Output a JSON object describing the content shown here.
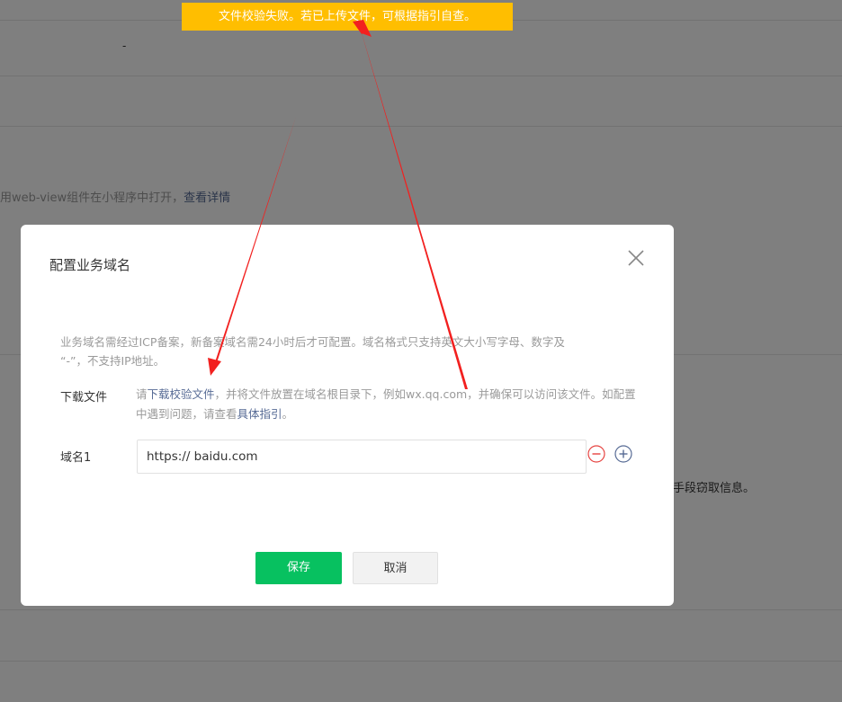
{
  "toast": {
    "message": "文件校验失败。若已上传文件，可根据指引自查。"
  },
  "background": {
    "dash": "-",
    "description_prefix": "用web-view组件在小程序中打开，",
    "description_link": "查看详情",
    "right_text": "手段窃取信息。"
  },
  "dialog": {
    "title": "配置业务域名",
    "tip_line1": "业务域名需经过ICP备案，新备案域名需24小时后才可配置。域名格式只支持英文大小写字母、数字及",
    "tip_line2": "“-”，不支持IP地址。",
    "download": {
      "label": "下载文件",
      "text_prefix": "请",
      "link": "下载校验文件",
      "text_middle": "，并将文件放置在域名根目录下，例如wx.qq.com，并确保可以访问该文件。如配置中遇到问题，请查看",
      "guide_link": "具体指引",
      "text_suffix": "。"
    },
    "domain": {
      "label": "域名1",
      "value": "https:// baidu.com"
    },
    "buttons": {
      "save": "保存",
      "cancel": "取消"
    }
  },
  "colors": {
    "toast": "#ffbe00",
    "primary": "#07c160",
    "link": "#576b95",
    "remove": "#e64340",
    "add": "#576b95",
    "annotation_arrow": "#f2201f"
  }
}
